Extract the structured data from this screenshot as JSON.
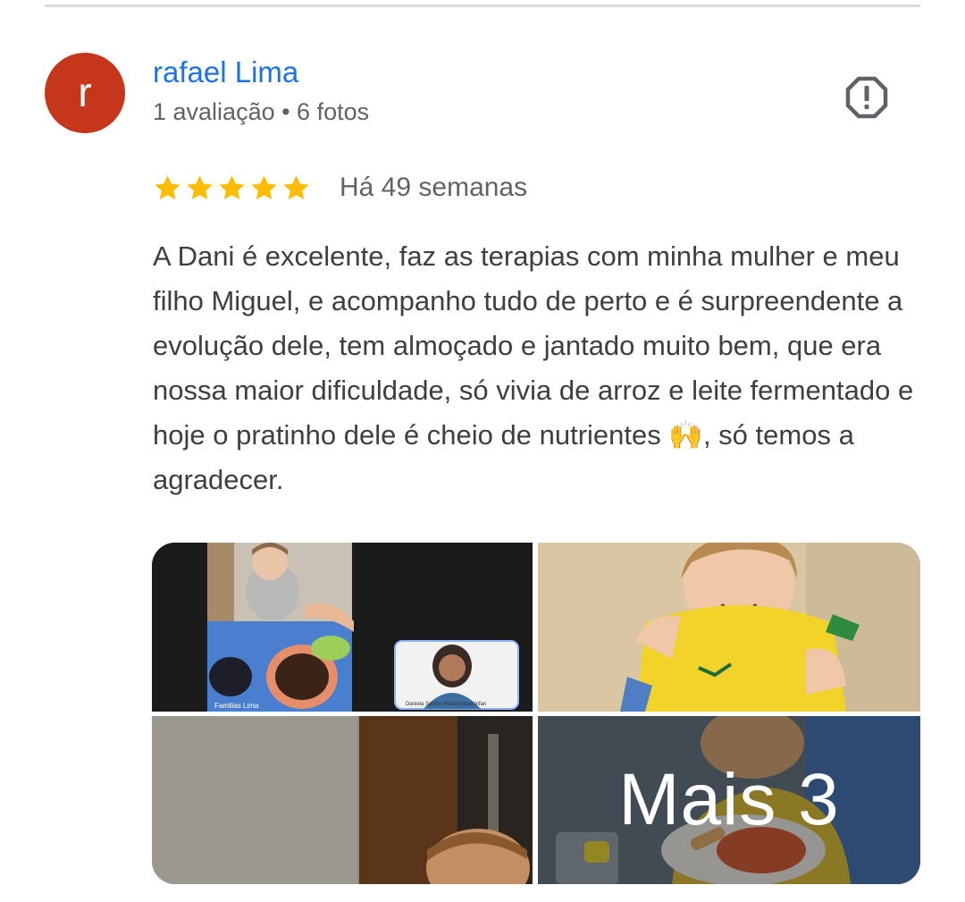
{
  "review": {
    "author": {
      "avatar_initial": "r",
      "avatar_color": "#c5361a",
      "name": "rafael Lima",
      "meta": "1 avaliação • 6 fotos"
    },
    "report_icon": "report-flag-icon",
    "rating": {
      "stars": 5,
      "max_stars": 5,
      "star_color": "#fbbc04"
    },
    "date": "Há 49 semanas",
    "text": "A Dani é excelente, faz as terapias com minha mulher e meu filho Miguel, e acompanho tudo de perto e é surpreendente a evolução dele, tem almoçado e jantado muito bem, que era nossa maior dificuldade, só vivia de arroz e leite fermentado e hoje o pratinho dele é cheio de nutrientes 🙌, só temos a agradecer.",
    "photos": {
      "more_label": "Mais 3",
      "video_call_caption_left": "Familias Lima",
      "video_call_caption_right": "Daniela Santos Nutricionista Infan"
    }
  },
  "colors": {
    "link": "#1a73e8",
    "secondary_text": "#5f6368",
    "body_text": "#3c4043"
  }
}
